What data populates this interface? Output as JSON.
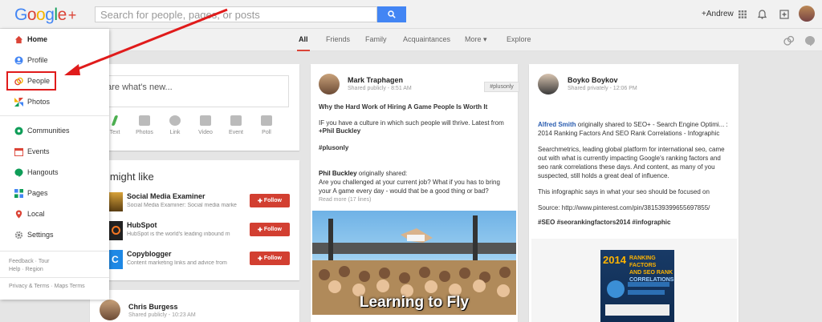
{
  "header": {
    "logo_letters": [
      "G",
      "o",
      "o",
      "g",
      "l",
      "e"
    ],
    "logo_plus": "+",
    "search_placeholder": "Search for people, pages, or posts",
    "user": "+Andrew"
  },
  "subnav": {
    "tabs": [
      {
        "label": "All",
        "active": true
      },
      {
        "label": "Friends"
      },
      {
        "label": "Family"
      },
      {
        "label": "Acquaintances"
      },
      {
        "label": "More"
      },
      {
        "label": "Explore"
      }
    ]
  },
  "drawer": {
    "items": [
      {
        "label": "Home",
        "icon": "home-icon"
      },
      {
        "label": "Profile",
        "icon": "profile-icon"
      },
      {
        "label": "People",
        "icon": "people-icon"
      },
      {
        "label": "Photos",
        "icon": "photos-icon"
      },
      {
        "label": "Communities",
        "icon": "communities-icon"
      },
      {
        "label": "Events",
        "icon": "events-icon"
      },
      {
        "label": "Hangouts",
        "icon": "hangouts-icon"
      },
      {
        "label": "Pages",
        "icon": "pages-icon"
      },
      {
        "label": "Local",
        "icon": "local-icon"
      },
      {
        "label": "Settings",
        "icon": "settings-icon"
      }
    ],
    "footer1": "Feedback · Tour",
    "footer2": "Help · Region",
    "footer3": "Privacy & Terms · Maps Terms"
  },
  "share": {
    "placeholder": "hare what's new...",
    "tools": [
      "Text",
      "Photos",
      "Link",
      "Video",
      "Event",
      "Poll"
    ]
  },
  "suggestions": {
    "title": "u might like",
    "follow_label": "Follow",
    "items": [
      {
        "name": "Social Media Examiner",
        "desc": "Social Media Examiner: Social media marke"
      },
      {
        "name": "HubSpot",
        "desc": "HubSpot is the world's leading inbound m"
      },
      {
        "name": "Copyblogger",
        "desc": "Content marketing links and advice from"
      }
    ]
  },
  "post_bottom": {
    "name": "Chris Burgess",
    "meta": "Shared publicly  -  10:23 AM"
  },
  "post1": {
    "name": "Mark Traphagen",
    "meta": "Shared publicly  -  8:51 AM",
    "badge": "#plusonly",
    "title": "Why the Hard Work of Hiring A Game People Is Worth It",
    "line1": "IF you have a culture in which such people will thrive. Latest from",
    "mention": "+Phil Buckley",
    "tag": "#plusonly",
    "reshare_name": "Phil Buckley",
    "reshare_suffix": " originally shared:",
    "reshare_l1": "Are you challenged at your current job? What if you has to bring",
    "reshare_l2": "your A game every day - would that be a good thing or bad?",
    "readmore": "Read more (17 lines)",
    "photo_caption": "Learning to Fly"
  },
  "post2": {
    "name": "Boyko Boykov",
    "meta": "Shared privately  -  12:06 PM",
    "orig_name": "Alfred Smith",
    "orig_suffix": " originally shared to SEO+ - Search Engine Optimi... :",
    "orig_l2": "2014 Ranking Factors And SEO Rank Correlations - Infographic",
    "p1": "Searchmetrics, leading global platform for international seo, came",
    "p2": "out with what is currently impacting Google's ranking factors and",
    "p3": "seo rank correlations these days. And content, as many of you",
    "p4": "suspected, still holds a great deal of influence.",
    "p5": "This infographic says  in what your seo should be focused on",
    "p6": "Source: http://www.pinterest.com/pin/381539399655697855/",
    "tags": "#SEO   #seorankingfactors2014   #infographic",
    "info_year": "2014",
    "info_t1": "RANKING FACTORS",
    "info_t2": "AND SEO RANK",
    "info_t3": "CORRELATIONS"
  }
}
